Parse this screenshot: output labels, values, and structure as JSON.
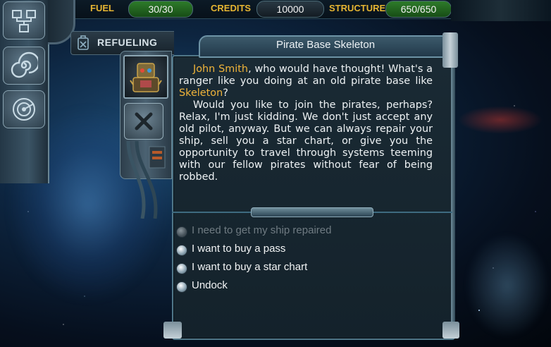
{
  "topbar": {
    "fuel_label": "FUEL",
    "fuel_value": "30/30",
    "credits_label": "CREDITS",
    "credits_value": "10000",
    "structure_label": "STRUCTURE",
    "structure_value": "650/650"
  },
  "sidebar": {
    "items": [
      {
        "icon": "network-icon"
      },
      {
        "icon": "spiral-icon"
      },
      {
        "icon": "radar-icon"
      }
    ]
  },
  "section": {
    "label": "REFUELING",
    "icon": "fuel-canister-icon"
  },
  "dialog": {
    "title": "Pirate Base Skeleton",
    "speaker_name": "John Smith",
    "p1_after_name": ", who would have thought! What's a ranger like you doing at an old pirate base like ",
    "base_name": "Skeleton",
    "p1_end": "?",
    "p2": "Would you like to join the pirates, perhaps? Relax, I'm just kidding. We don't just accept any old pilot, anyway. But we can always repair your ship, sell you a star chart, or give you the opportunity to travel through systems teeming with our fellow pirates without fear of being robbed."
  },
  "choices": [
    {
      "label": "I need to get my ship repaired",
      "enabled": false
    },
    {
      "label": "I want to buy a pass",
      "enabled": true
    },
    {
      "label": "I want to buy a star chart",
      "enabled": true
    },
    {
      "label": "Undock",
      "enabled": true
    }
  ],
  "colors": {
    "accent_gold": "#f0b43a",
    "fuel_green": "#2e7b2a",
    "panel_bg": "#1a2a34"
  }
}
